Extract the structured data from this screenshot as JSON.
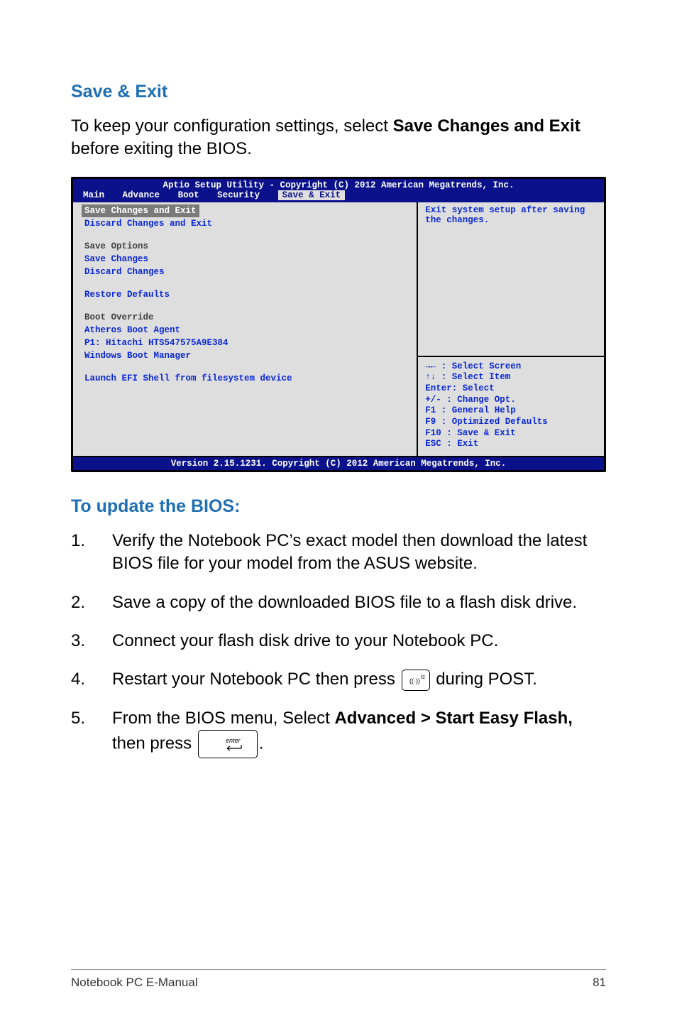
{
  "headings": {
    "save_exit": "Save & Exit",
    "update_bios": "To update the BIOS:"
  },
  "intro": {
    "pre": "To keep your configuration settings, select ",
    "bold": "Save Changes and Exit",
    "post": " before exiting the BIOS."
  },
  "bios": {
    "header": "Aptio Setup Utility - Copyright (C) 2012 American Megatrends, Inc.",
    "tabs": [
      "Main",
      "Advance",
      "Boot",
      "Security",
      "Save & Exit"
    ],
    "active_tab_index": 4,
    "left_items": [
      {
        "text": "Save Changes and Exit",
        "type": "selected"
      },
      {
        "text": "Discard Changes and Exit",
        "type": "item"
      },
      {
        "text": "",
        "type": "spacer"
      },
      {
        "text": "Save Options",
        "type": "group"
      },
      {
        "text": "Save Changes",
        "type": "item"
      },
      {
        "text": "Discard Changes",
        "type": "item"
      },
      {
        "text": "",
        "type": "spacer"
      },
      {
        "text": "Restore Defaults",
        "type": "item"
      },
      {
        "text": "",
        "type": "spacer"
      },
      {
        "text": "Boot Override",
        "type": "group"
      },
      {
        "text": "Atheros Boot Agent",
        "type": "item"
      },
      {
        "text": "P1: Hitachi HTS547575A9E384",
        "type": "item"
      },
      {
        "text": "Windows Boot Manager",
        "type": "item"
      },
      {
        "text": "",
        "type": "spacer"
      },
      {
        "text": "Launch EFI Shell from filesystem device",
        "type": "item"
      }
    ],
    "help_top": "Exit system setup after saving the changes.",
    "help_bottom": [
      "→←  : Select Screen",
      "↑↓  : Select Item",
      "Enter: Select",
      "+/-  : Change Opt.",
      "F1   : General Help",
      "F9   : Optimized Defaults",
      "F10  : Save & Exit",
      "ESC  : Exit"
    ],
    "footer": "Version 2.15.1231. Copyright (C) 2012 American Megatrends, Inc."
  },
  "steps": {
    "s1": "Verify the Notebook PC’s exact model then download the latest BIOS file for your model from the ASUS website.",
    "s2": "Save a copy of the downloaded BIOS file to a flash disk drive.",
    "s3": "Connect your flash disk drive to your Notebook PC.",
    "s4_pre": "Restart your Notebook PC then press ",
    "s4_post": " during POST.",
    "s5_pre": "From the BIOS menu, Select ",
    "s5_bold": "Advanced > Start Easy Flash,",
    "s5_mid": " then press ",
    "s5_post": "."
  },
  "keycaps": {
    "f2_sup": "f2",
    "enter_label": "enter"
  },
  "footer": {
    "left": "Notebook PC E-Manual",
    "right": "81"
  }
}
